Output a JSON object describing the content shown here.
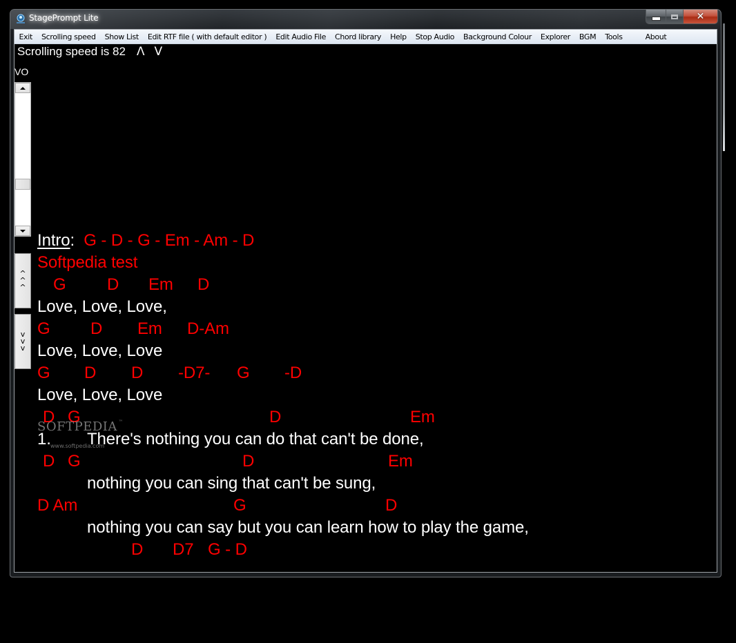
{
  "window": {
    "title": "StagePrompt Lite",
    "icon": "stageprompt-app-icon",
    "caption_buttons": {
      "minimize": "minimize-icon",
      "maximize": "maximize-icon",
      "close": "✕"
    }
  },
  "menu": [
    {
      "label": "Exit"
    },
    {
      "label": "Scrolling speed"
    },
    {
      "label": "Show List"
    },
    {
      "label": "Edit RTF file ( with default editor )"
    },
    {
      "label": "Edit Audio File"
    },
    {
      "label": "Chord library"
    },
    {
      "label": "Help"
    },
    {
      "label": "Stop Audio"
    },
    {
      "label": "Background Colour"
    },
    {
      "label": "Explorer"
    },
    {
      "label": "BGM"
    },
    {
      "label": "Tools"
    },
    {
      "label": "About"
    }
  ],
  "speed": {
    "label": "Scrolling speed is",
    "value": "82",
    "increase": "Λ",
    "decrease": "V"
  },
  "volume_label": "VO",
  "volume_scroll": {
    "fraction": 0.62
  },
  "jump_buttons": {
    "up": [
      "^",
      "^",
      "^"
    ],
    "down": [
      "v",
      "v",
      "v"
    ]
  },
  "colors": {
    "background": "#000000",
    "lyrics": "#ffffff",
    "chords": "#ff0000"
  },
  "song": {
    "intro_label": "Intro",
    "intro_colon": ":",
    "intro_chords": "G - D - G - Em - Am - D",
    "title": "Softpedia test",
    "lines": [
      {
        "type": "chords",
        "chords": [
          "G",
          "D",
          "Em",
          "D"
        ]
      },
      {
        "type": "lyric",
        "text": "Love, Love, Love,"
      },
      {
        "type": "chords",
        "chords": [
          "G",
          "D",
          "Em",
          "D-Am"
        ]
      },
      {
        "type": "lyric",
        "text": "Love, Love, Love"
      },
      {
        "type": "chords",
        "chords": [
          "G",
          "D",
          "D",
          "-D7-",
          "G",
          "-D"
        ]
      },
      {
        "type": "lyric",
        "text": "Love, Love, Love"
      },
      {
        "type": "chords",
        "chords": [
          "D",
          "G",
          "D",
          "Em"
        ]
      },
      {
        "type": "lyric",
        "number": "1.",
        "text": "There's nothing you can do that can't be done,"
      },
      {
        "type": "chords",
        "chords": [
          "D",
          "G",
          "D",
          "Em"
        ]
      },
      {
        "type": "lyric",
        "text": "nothing you can sing that can't be sung,"
      },
      {
        "type": "chords",
        "chords": [
          "D Am",
          "G",
          "D"
        ]
      },
      {
        "type": "lyric",
        "text": "nothing you can say but you can learn how to play the game,"
      },
      {
        "type": "chords",
        "chords": [
          "D",
          "D7",
          "G - D"
        ]
      }
    ]
  },
  "watermark": {
    "text": "SOFTPEDIA",
    "tm": "™",
    "url": "www.softpedia.com"
  }
}
